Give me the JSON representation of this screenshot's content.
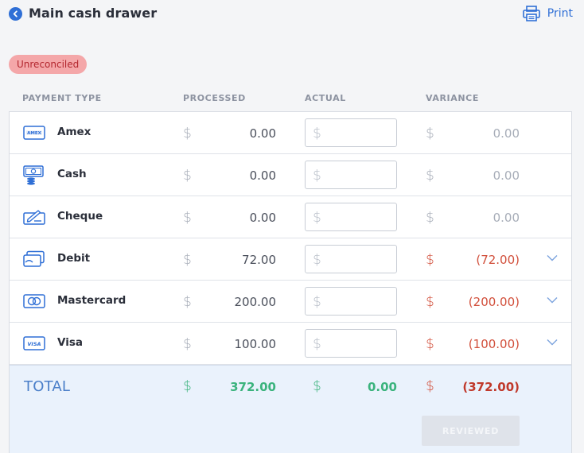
{
  "header": {
    "title": "Main cash drawer",
    "print_label": "Print"
  },
  "status_badge": "Unreconciled",
  "columns": {
    "payment_type": "PAYMENT TYPE",
    "processed": "PROCESSED",
    "actual": "ACTUAL",
    "variance": "VARIANCE"
  },
  "currency_symbol": "$",
  "rows": [
    {
      "label": "Amex",
      "icon": "amex-card-icon",
      "processed": "0.00",
      "actual_placeholder": "",
      "variance": "0.00",
      "variance_status": "neutral",
      "expandable": false
    },
    {
      "label": "Cash",
      "icon": "cash-icon",
      "processed": "0.00",
      "actual_placeholder": "",
      "variance": "0.00",
      "variance_status": "neutral",
      "expandable": false
    },
    {
      "label": "Cheque",
      "icon": "cheque-icon",
      "processed": "0.00",
      "actual_placeholder": "",
      "variance": "0.00",
      "variance_status": "neutral",
      "expandable": false
    },
    {
      "label": "Debit",
      "icon": "debit-card-icon",
      "processed": "72.00",
      "actual_placeholder": "",
      "variance": "(72.00)",
      "variance_status": "negative",
      "expandable": true
    },
    {
      "label": "Mastercard",
      "icon": "mastercard-icon",
      "processed": "200.00",
      "actual_placeholder": "",
      "variance": "(200.00)",
      "variance_status": "negative",
      "expandable": true
    },
    {
      "label": "Visa",
      "icon": "visa-card-icon",
      "processed": "100.00",
      "actual_placeholder": "",
      "variance": "(100.00)",
      "variance_status": "negative",
      "expandable": true
    }
  ],
  "total": {
    "label": "TOTAL",
    "processed": "372.00",
    "actual": "0.00",
    "variance": "(372.00)"
  },
  "reviewed_button": "REVIEWED",
  "colors": {
    "accent": "#2f6fd6",
    "badge_bg": "#f4a7a9",
    "negative": "#d2503c",
    "positive": "#3bb37d",
    "total_bg": "#eaf2fc"
  }
}
